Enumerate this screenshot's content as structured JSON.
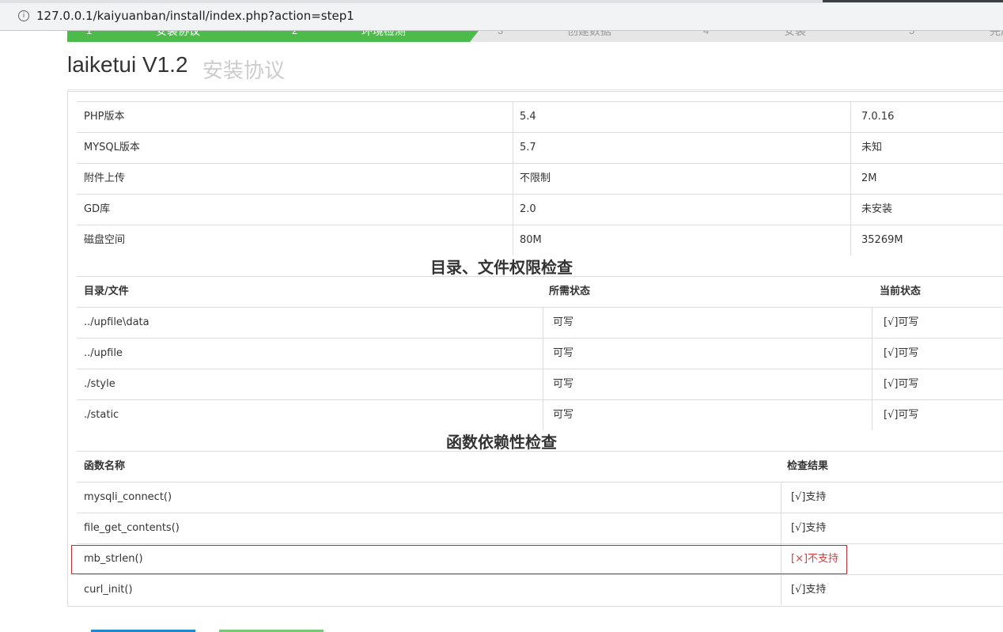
{
  "browser": {
    "url": "127.0.0.1/kaiyuanban/install/index.php?action=step1",
    "info_icon": "info-icon"
  },
  "steps": [
    {
      "label": "安装协议",
      "status": "done"
    },
    {
      "label": "环境检测",
      "status": "done"
    },
    {
      "label": "创建数据",
      "status": "todo"
    },
    {
      "label": "安装",
      "status": "todo"
    },
    {
      "label": "完成",
      "status": "todo"
    }
  ],
  "header": {
    "title": "laiketui V1.2",
    "subtitle": "安装协议"
  },
  "env_table": {
    "rows": [
      {
        "name": "PHP版本",
        "required": "5.4",
        "current": "7.0.16"
      },
      {
        "name": "MYSQL版本",
        "required": "5.7",
        "current": "未知"
      },
      {
        "name": "附件上传",
        "required": "不限制",
        "current": "2M"
      },
      {
        "name": "GD库",
        "required": "2.0",
        "current": "未安装"
      },
      {
        "name": "磁盘空间",
        "required": "80M",
        "current": "35269M"
      }
    ]
  },
  "dir_section": {
    "title": "目录、文件权限检查",
    "headers": {
      "path": "目录/文件",
      "required": "所需状态",
      "current": "当前状态"
    },
    "rows": [
      {
        "path": "../upfile\\data",
        "required": "可写",
        "current": "[√]可写"
      },
      {
        "path": "../upfile",
        "required": "可写",
        "current": "[√]可写"
      },
      {
        "path": "./style",
        "required": "可写",
        "current": "[√]可写"
      },
      {
        "path": "./static",
        "required": "可写",
        "current": "[√]可写"
      }
    ]
  },
  "func_section": {
    "title": "函数依赖性检查",
    "headers": {
      "name": "函数名称",
      "result": "检查结果"
    },
    "rows": [
      {
        "name": "mysqli_connect()",
        "result": "[√]支持",
        "ok": true
      },
      {
        "name": "file_get_contents()",
        "result": "[√]支持",
        "ok": true
      },
      {
        "name": "mb_strlen()",
        "result": "[×]不支持",
        "ok": false
      },
      {
        "name": "curl_init()",
        "result": "[√]支持",
        "ok": true
      }
    ]
  },
  "colors": {
    "step_done": "#4cbb4c",
    "step_todo": "#e6e6e6",
    "fail_text": "#e4393c",
    "highlight_border": "#d9252a",
    "btn_primary": "#1e88d0",
    "btn_secondary": "#78c878"
  }
}
